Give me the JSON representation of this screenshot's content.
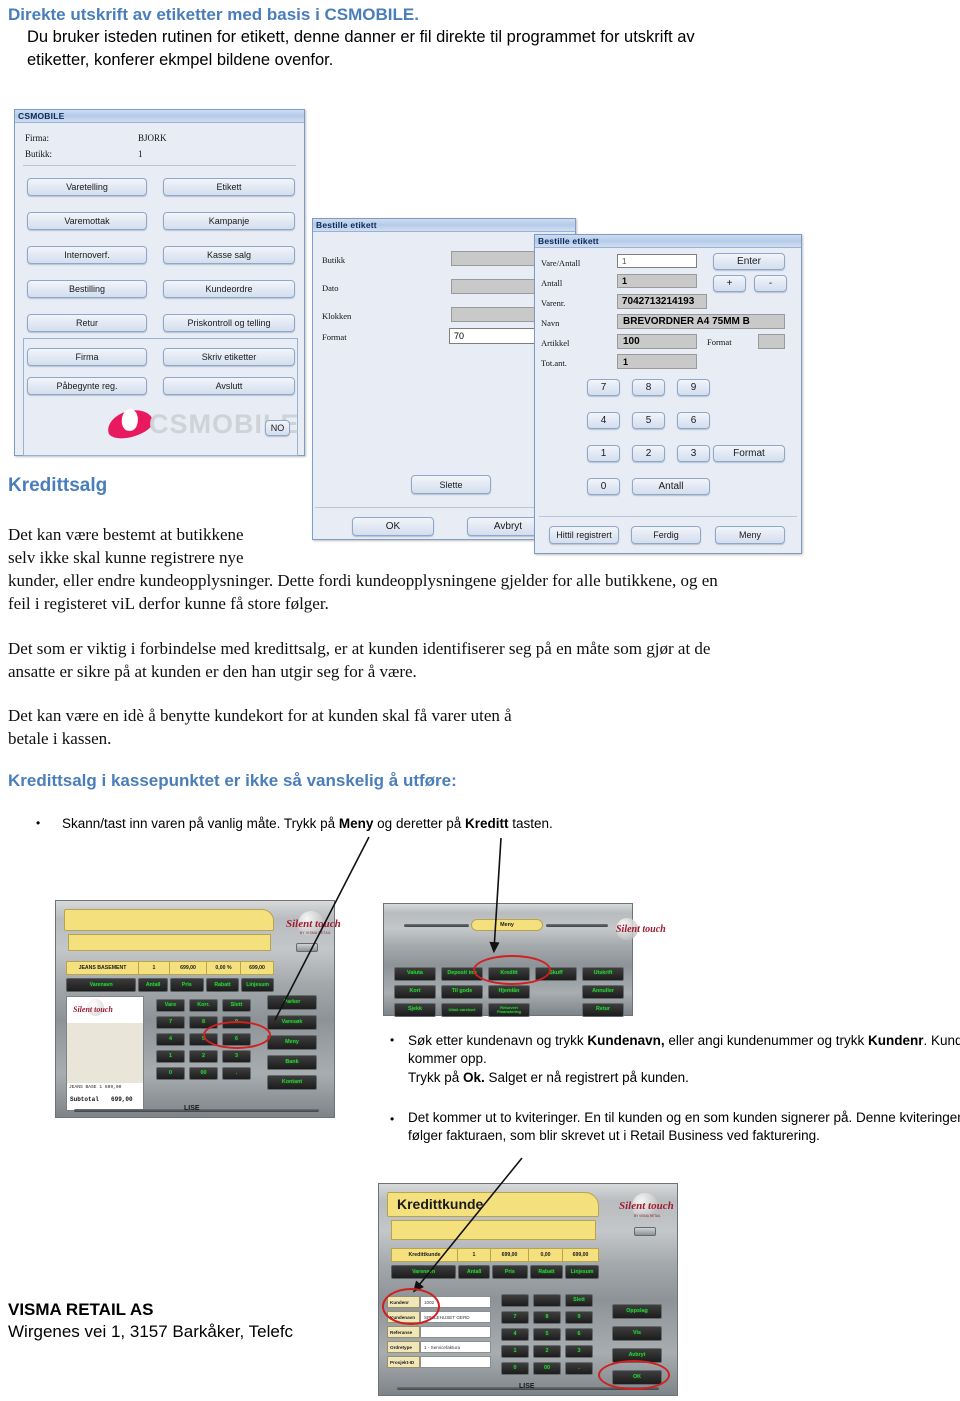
{
  "document": {
    "heading1": "Direkte utskrift av etiketter med basis i CSMOBILE.",
    "para1_line1": "Du bruker isteden rutinen for etikett, denne danner er fil direkte til programmet for utskrift av",
    "para1_line2": "etiketter, konferer ekmpel bildene ovenfor.",
    "heading2": "Kredittsalg",
    "para2_line1": "Det kan være bestemt at butikkene",
    "para2_line2": "selv ikke skal kunne registrere nye",
    "para2_line3": "kunder, eller endre kundeopplysninger.  Dette fordi kundeopplysningene gjelder for alle butikkene, og en",
    "para2_line4": "feil i registeret viL derfor kunne få store følger.",
    "para3_line1": "Det som er viktig i forbindelse med kredittsalg, er at kunden identifiserer  seg på en måte som gjør at de",
    "para3_line2": "ansatte er sikre på at kunden er den han utgir seg for å være.",
    "para4_line1": "Det kan være en idè å benytte kundekort for at kunden skal få varer uten å",
    "para4_line2": "betale i kassen.",
    "heading3": "Kredittsalg i kassepunktet er ikke så vanskelig å utføre:",
    "bullet1": {
      "pre": "Skann/tast inn varen på vanlig måte. Trykk på ",
      "b1": "Meny",
      "mid": " og deretter på ",
      "b2": "Kreditt",
      "post": " tasten."
    },
    "bullet2": {
      "l1_pre": "Søk etter kundenavn og trykk ",
      "l1_b1": "Kundenavn,",
      "l1_mid": " eller angi kundenummer og trykk ",
      "l1_b2": "Kundenr",
      "l1_post": ". Kunden",
      "l2": "kommer opp.",
      "l3_pre": "Trykk på ",
      "l3_b": "Ok.",
      "l3_post": " Salget er nå registrert på kunden."
    },
    "bullet3": {
      "l1": "Det kommer ut to kviteringer.  En til kunden og en som kunden signerer på. Denne kviteringen",
      "l2": "følger fakturaen,  som blir skrevet ut i Retail Business ved fakturering."
    },
    "footer_company": "VISMA RETAIL AS",
    "footer_address": "Wirgenes vei 1, 3157 Barkåker, Telefc"
  },
  "csmobile_window": {
    "title": "CSMOBILE",
    "fields": [
      {
        "label": "Firma:",
        "value": "BJORK"
      },
      {
        "label": "Butikk:",
        "value": "1"
      }
    ],
    "buttons_left": [
      "Varetelling",
      "Varemottak",
      "Internoverf.",
      "Bestilling",
      "Retur"
    ],
    "buttons_right": [
      "Etikett",
      "Kampanje",
      "Kasse salg",
      "Kundeordre",
      "Priskontroll og telling"
    ],
    "buttons_bottom_left": [
      "Firma",
      "Påbegynte reg."
    ],
    "buttons_bottom_right": [
      "Skriv etiketter",
      "Avslutt"
    ],
    "watermark": "CSMOBILE",
    "lang_button": "NO"
  },
  "bestille_etikett_left": {
    "title": "Bestille etikett",
    "rows": [
      {
        "label": "Butikk",
        "value": ""
      },
      {
        "label": "Dato",
        "value": ""
      },
      {
        "label": "Klokken",
        "value": ""
      },
      {
        "label": "Format",
        "value": "70"
      }
    ],
    "delete_button": "Slette",
    "ok_button": "OK",
    "cancel_button": "Avbryt"
  },
  "bestille_etikett_right": {
    "title": "Bestille etikett",
    "rows": [
      {
        "label": "Vare/Antall",
        "value": "1"
      },
      {
        "label": "Antall",
        "value": "1"
      },
      {
        "label": "Varenr.",
        "value": "7042713214193"
      },
      {
        "label": "Navn",
        "value": "BREVORDNER A4 75MM B"
      },
      {
        "label": "Artikkel",
        "value": "100"
      },
      {
        "label": "Tot.ant.",
        "value": "1"
      }
    ],
    "format_label": "Format",
    "format_value": "",
    "enter_button": "Enter",
    "plus_button": "+",
    "minus_button": "-",
    "keypad": [
      "7",
      "8",
      "9",
      "4",
      "5",
      "6",
      "1",
      "2",
      "3",
      "0"
    ],
    "format_button": "Format",
    "antall_button": "Antall",
    "footer_buttons": [
      "Hittil registrert",
      "Ferdig",
      "Meny"
    ]
  },
  "pos_sale": {
    "logo": "Silent touch",
    "logo_sub": "BY VISMA RETAIL",
    "line_item": [
      "JEANS BASEMENT",
      "1",
      "699,00",
      "0,00 %",
      "699,00"
    ],
    "columns": [
      "Varenavn",
      "Antall",
      "Pris",
      "Rabatt",
      "Linjesum"
    ],
    "keypad_top": [
      "Vare",
      "Korr.",
      "Slett"
    ],
    "keypad": [
      "7",
      "8",
      "9",
      "4",
      "5",
      "6",
      "1",
      "2",
      "3",
      "0",
      "00",
      "."
    ],
    "side_buttons": [
      "Parker",
      "Varesøk",
      "Meny",
      "Bank",
      "Kontant"
    ],
    "receipt_line": "JEANS BASE      1        699,00",
    "receipt_subtotal_label": "Subtotal",
    "receipt_subtotal_value": "699,00",
    "footer": "LISE"
  },
  "pos_menu": {
    "tab": "Meny",
    "buttons": [
      [
        "Valuta",
        "Deposit inn",
        "Kreditt",
        "Skuff",
        "Utskrift"
      ],
      [
        "Kort",
        "Til gode",
        "Hjemlån",
        "",
        "Annuller"
      ],
      [
        "Sjekk",
        "Uttak varekort",
        "Returvert Finansiering",
        "",
        "Retur"
      ]
    ]
  },
  "pos_credit": {
    "title": "Kredittkunde",
    "logo": "Silent touch",
    "logo_sub": "BY VISMA RETAIL",
    "line_item": [
      "Kredittkunde",
      "1",
      "699,00",
      "0,00",
      "699,00"
    ],
    "columns": [
      "Varenavn",
      "Antall",
      "Pris",
      "Rabatt",
      "Linjesum"
    ],
    "form": [
      {
        "label": "Kundenr",
        "value": "1002"
      },
      {
        "label": "Kundenavn",
        "value": "SPILLEHUSET GERD"
      },
      {
        "label": "Referanse",
        "value": ""
      },
      {
        "label": "Ordretype",
        "value": "1 - Servicefaktura"
      },
      {
        "label": "Prosjekt-ID",
        "value": ""
      }
    ],
    "keypad_top": [
      "",
      "",
      "Slett"
    ],
    "keypad": [
      "7",
      "8",
      "9",
      "4",
      "5",
      "6",
      "1",
      "2",
      "3",
      "0",
      "00",
      "."
    ],
    "side_buttons": [
      "Oppslag",
      "Vis",
      "Avbryt",
      "OK"
    ],
    "footer": "LISE"
  },
  "colors": {
    "heading_blue": "#4a7ebb",
    "annotation_red": "#d21f1f",
    "pos_green": "#2fd13a",
    "pos_yellow": "#f5e07e",
    "logo_pink": "#e8195f"
  }
}
